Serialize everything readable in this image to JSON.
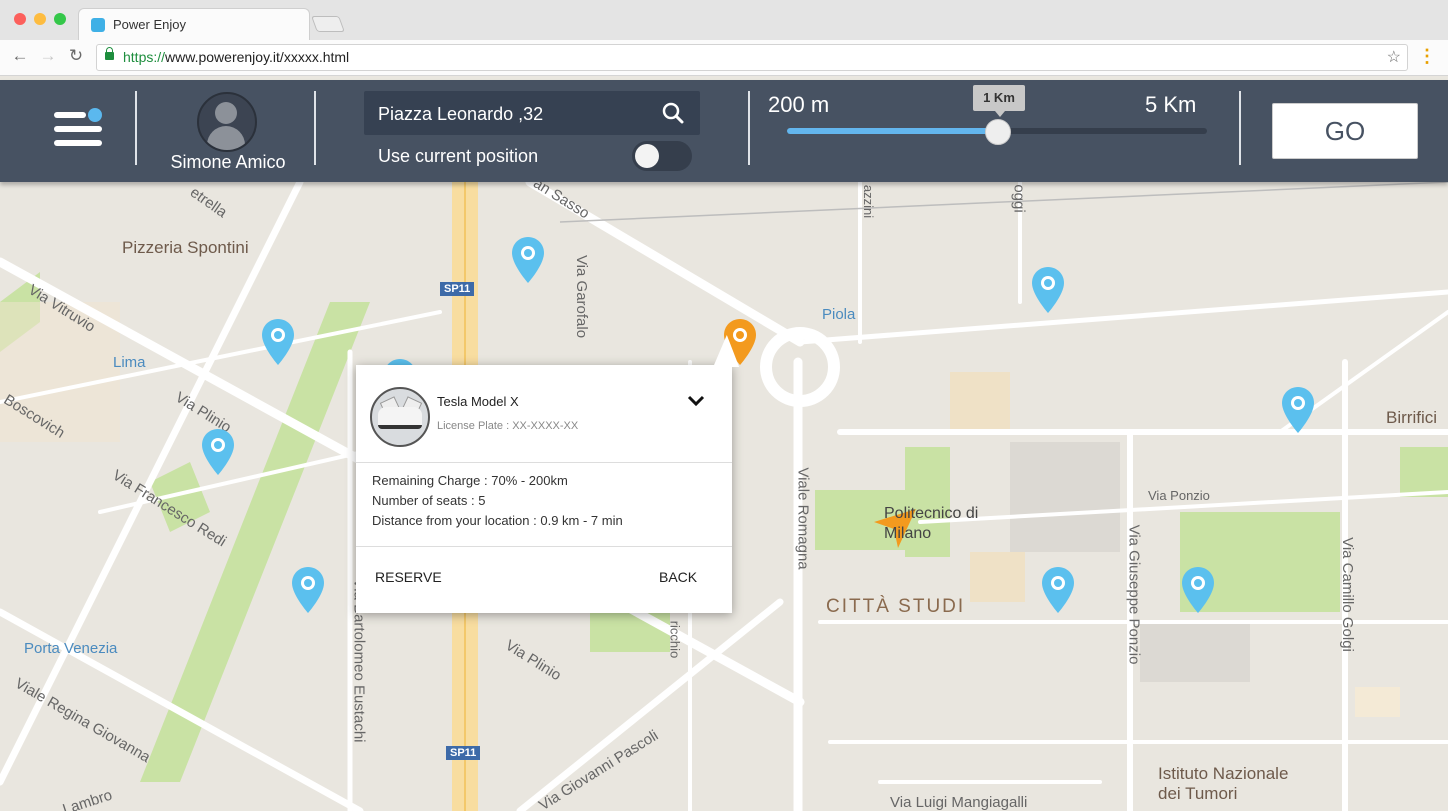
{
  "browser": {
    "tab_title": "Power Enjoy",
    "url_scheme": "https://",
    "url_rest": "www.powerenjoy.it/xxxxx.html",
    "traffic_colors": [
      "#fc605c",
      "#fdbc40",
      "#34c749"
    ]
  },
  "header": {
    "user_name": "Simone Amico",
    "search_value": "Piazza Leonardo ,32",
    "use_current_label": "Use current position",
    "use_current_on": false,
    "range_min": "200 m",
    "range_max": "5 Km",
    "range_selected": "1 Km",
    "range_fraction": 0.5,
    "go_label": "GO"
  },
  "map": {
    "labels": {
      "pizzeria": "Pizzeria Spontini",
      "lima": "Lima",
      "piola": "Piola",
      "porta_venezia": "Porta Venezia",
      "sp11_top": "SP11",
      "sp11_bottom": "SP11",
      "via_vitruvio": "Via Vitruvio",
      "via_boscovich": "Boscovich",
      "via_plinio_top": "Via Plinio",
      "via_francesco_redi": "Via Francesco Redi",
      "via_garofalo": "Via Garofalo",
      "via_bartolomeo_eustachi": "Via Bartolomeo Eustachi",
      "viale_romagna": "Viale Romagna",
      "via_plinio_bottom": "Via Plinio",
      "viale_regina_giovanna": "Viale Regina Giovanna",
      "via_giovanni_pascoli": "Via Giovanni Pascoli",
      "lambro": "Lambro",
      "via_luigi_mangiagalli": "Via Luigi Mangiagalli",
      "istituto": "Istituto Nazionale dei Tumori",
      "via_giuseppe_ponzio": "Via Giuseppe Ponzio",
      "via_camillo_golgi": "Via Camillo Golgi",
      "via_ponzio": "Via Ponzio",
      "politecnico": "Politecnico di Milano",
      "citta_studi": "CITTÀ STUDI",
      "birrifici": "Birrifici",
      "stretta": "etrella",
      "san_sasso": "an Sasso",
      "azzini": "azzini",
      "oggi": "oggi",
      "ricchio": "ricchio"
    },
    "pin_color": "#5bc0ee",
    "selected_pin_color": "#f39a1e",
    "road_color": "#ffffff",
    "park_color": "#c9e2a4",
    "highway_color": "#f8dda0"
  },
  "popup": {
    "car_name": "Tesla Model X",
    "plate": "License Plate : XX-XXXX-XX",
    "charge": "Remaining Charge : 70% - 200km",
    "seats": "Number of seats : 5",
    "distance": "Distance from your location : 0.9 km - 7 min",
    "reserve_label": "RESERVE",
    "back_label": "BACK"
  }
}
